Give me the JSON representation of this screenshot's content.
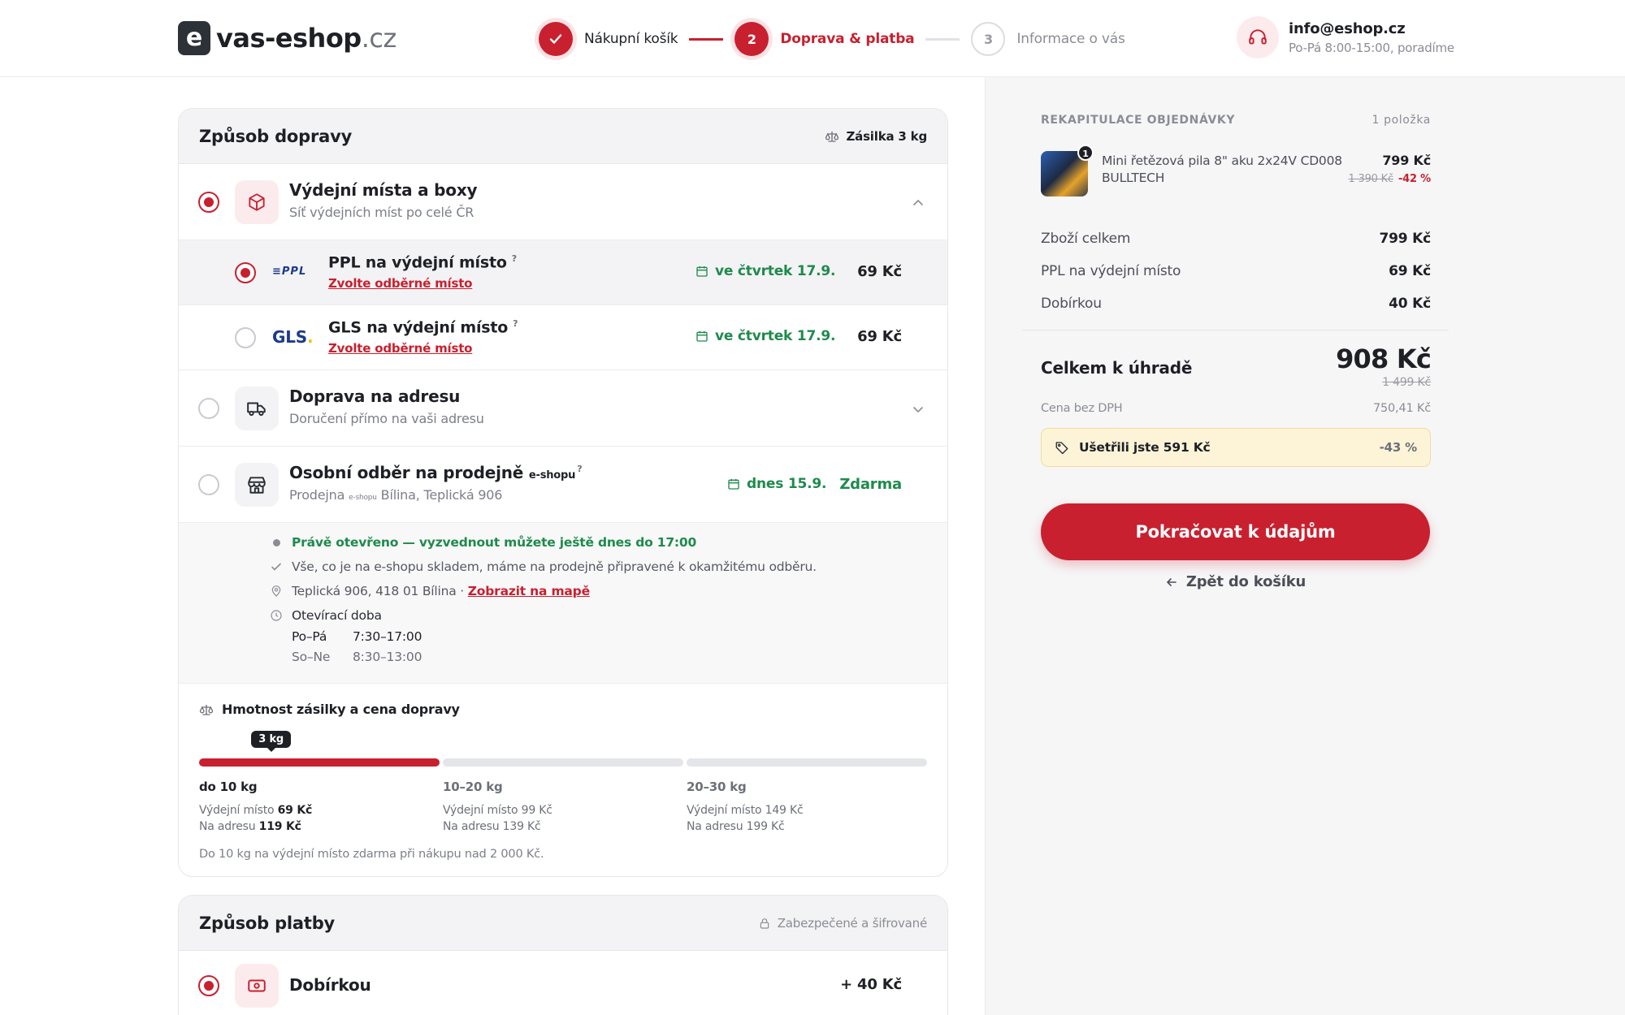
{
  "header": {
    "logo_mark": "e",
    "logo_name": "vas-eshop",
    "logo_tld": ".cz",
    "steps": [
      {
        "number": "✓",
        "label": "Nákupní košík",
        "state": "done"
      },
      {
        "number": "2",
        "label": "Doprava & platba",
        "state": "active"
      },
      {
        "number": "3",
        "label": "Informace o vás",
        "state": "todo"
      }
    ],
    "support_email": "info@eshop.cz",
    "support_hours": "Po-Pá 8:00-15:00, poradíme"
  },
  "shipping": {
    "title": "Způsob dopravy",
    "weight_badge": "Zásilka 3 kg",
    "groups": [
      {
        "title": "Výdejní místa a boxy",
        "subtitle": "Síť výdejních míst po celé ČR",
        "selected": true,
        "icon": "box-icon"
      },
      {
        "title": "Doprava na adresu",
        "subtitle": "Doručení přímo na vaši adresu",
        "selected": false,
        "icon": "truck-icon"
      }
    ],
    "options": [
      {
        "carrier": "PPL",
        "title": "PPL na výdejní místo",
        "help": "?",
        "link": "Zvolte odběrné místo",
        "date": "ve čtvrtek 17.9.",
        "price": "69 Kč",
        "selected": true
      },
      {
        "carrier": "GLS",
        "title": "GLS na výdejní místo",
        "help": "?",
        "link": "Zvolte odběrné místo",
        "date": "ve čtvrtek 17.9.",
        "price": "69 Kč",
        "selected": false
      }
    ],
    "store": {
      "title": "Osobní odběr na prodejně",
      "title_brand": "e-shopu",
      "help": "?",
      "sub_prefix": "Prodejna",
      "sub_brand": "e-shopu",
      "sub_suffix": "Bílina, Teplická 906",
      "date": "dnes 15.9.",
      "price": "Zdarma",
      "open_now": "Právě otevřeno — vyzvednout můžete ještě dnes do 17:00",
      "stock_note": "Vše, co je na e-shopu skladem, máme na prodejně připravené k okamžitému odběru.",
      "address": "Teplická 906, 418 01 Bílina ·",
      "map_link": "Zobrazit na mapě",
      "hours_title": "Otevírací doba",
      "hours": [
        {
          "days": "Po–Pá",
          "time": "7:30–17:00"
        },
        {
          "days": "So–Ne",
          "time": "8:30–13:00"
        }
      ]
    },
    "weight": {
      "title": "Hmotnost zásilky a cena dopravy",
      "current_label": "3 kg",
      "current_fraction": 0.3,
      "tiers": [
        {
          "label": "do 10 kg",
          "pickup_label": "Výdejní místo",
          "pickup_price": "69 Kč",
          "address_label": "Na adresu",
          "address_price": "119 Kč",
          "active": true
        },
        {
          "label": "10–20 kg",
          "pickup_label": "Výdejní místo",
          "pickup_price": "99 Kč",
          "address_label": "Na adresu",
          "address_price": "139 Kč",
          "active": false
        },
        {
          "label": "20–30 kg",
          "pickup_label": "Výdejní místo",
          "pickup_price": "149 Kč",
          "address_label": "Na adresu",
          "address_price": "199 Kč",
          "active": false
        }
      ],
      "note": "Do 10 kg na výdejní místo zdarma při nákupu nad 2 000 Kč."
    }
  },
  "payment": {
    "title": "Způsob platby",
    "secure_label": "Zabezpečené a šifrované",
    "options": [
      {
        "title": "Dobírkou",
        "price": "+ 40 Kč",
        "selected": true
      }
    ]
  },
  "summary": {
    "title": "REKAPITULACE OBJEDNÁVKY",
    "count": "1 položka",
    "item": {
      "qty": "1",
      "name": "Mini řetězová pila 8\" aku 2x24V CD008 BULLTECH",
      "price": "799 Kč",
      "old_price": "1 390 Kč",
      "discount": "-42 %"
    },
    "rows": [
      {
        "label": "Zboží celkem",
        "value": "799 Kč"
      },
      {
        "label": "PPL na výdejní místo",
        "value": "69 Kč"
      },
      {
        "label": "Dobírkou",
        "value": "40 Kč"
      }
    ],
    "total_label": "Celkem k úhradě",
    "total": "908 Kč",
    "total_old": "1 499 Kč",
    "vat_label": "Cena bez DPH",
    "vat_value": "750,41 Kč",
    "savings_label": "Ušetřili jste 591 Kč",
    "savings_pct": "-43 %",
    "cta": "Pokračovat k údajům",
    "back": "Zpět do košíku"
  },
  "colors": {
    "accent": "#c8202f",
    "green": "#1f8a4c",
    "panel": "#f6f6f7",
    "savings_bg": "#fdf4d8"
  }
}
